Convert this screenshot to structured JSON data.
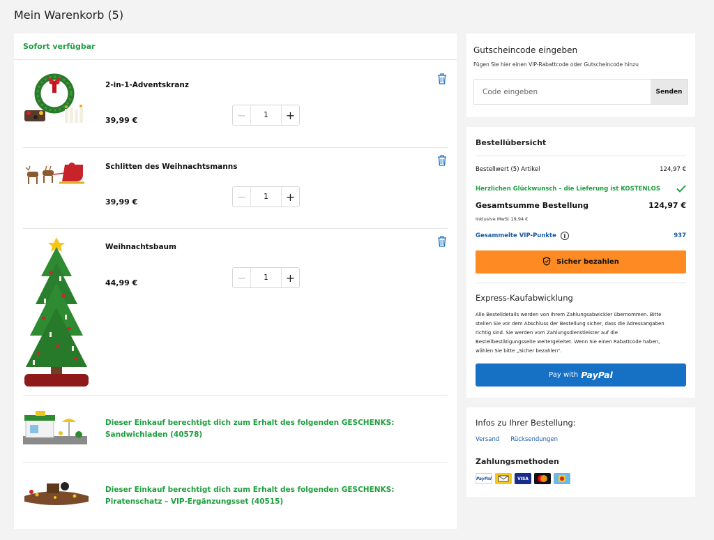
{
  "page": {
    "title": "Mein Warenkorb (5)"
  },
  "cart": {
    "availability": "Sofort verfügbar",
    "items": [
      {
        "name": "2-in-1-Adventskranz",
        "price": "39,99 €",
        "qty": "1"
      },
      {
        "name": "Schlitten des Weihnachtsmanns",
        "price": "39,99 €",
        "qty": "1"
      },
      {
        "name": "Weihnachtsbaum",
        "price": "44,99 €",
        "qty": "1"
      }
    ],
    "gifts": [
      {
        "line1": "Dieser Einkauf berechtigt dich zum Erhalt des folgenden GESCHENKS:",
        "line2": "Sandwichladen (40578)"
      },
      {
        "line1": "Dieser Einkauf berechtigt dich zum Erhalt des folgenden GESCHENKS:",
        "line2": "Piratenschatz – VIP-Ergänzungsset (40515)"
      }
    ]
  },
  "coupon": {
    "title": "Gutscheincode eingeben",
    "subtitle": "Fügen Sie hier einen VIP-Rabattcode oder Gutscheincode hinzu",
    "placeholder": "Code eingeben",
    "button": "Senden"
  },
  "summary": {
    "title": "Bestellübersicht",
    "order_value_label": "Bestellwert (5) Artikel",
    "order_value": "124,97 €",
    "free_delivery": "Herzlichen Glückwunsch – die Lieferung ist KOSTENLOS",
    "total_label": "Gesamtsumme Bestellung",
    "total": "124,97 €",
    "vat": "Inklusive MwSt 19,94 €",
    "vip_label": "Gesammelte VIP-Punkte",
    "vip_points": "937",
    "pay_button": "Sicher bezahlen",
    "express_title": "Express-Kaufabwicklung",
    "express_text": "Alle Bestelldetails werden von Ihrem Zahlungsabwickler übernommen. Bitte stellen Sie vor dem Abschluss der Bestellung sicher, dass die Adressangaben richtig sind. Sie werden vom Zahlungsdienstleister auf die Bestellbestätigungsseite weitergeleitet. Wenn Sie einen Rabattcode haben, wählen Sie bitte „Sicher bezahlen“.",
    "paypal_prefix": "Pay with",
    "paypal_brand": "PayPal"
  },
  "infos": {
    "title": "Infos zu Ihrer Bestellung:",
    "links": [
      "Versand",
      "Rücksendungen"
    ],
    "payment_title": "Zahlungsmethoden",
    "payment_icons": [
      "PayPal",
      "VISA"
    ]
  },
  "colors": {
    "accent_orange": "#fd8a22",
    "paypal_blue": "#1670c4",
    "success_green": "#1e9e3f",
    "link_blue": "#1a5aa8"
  }
}
